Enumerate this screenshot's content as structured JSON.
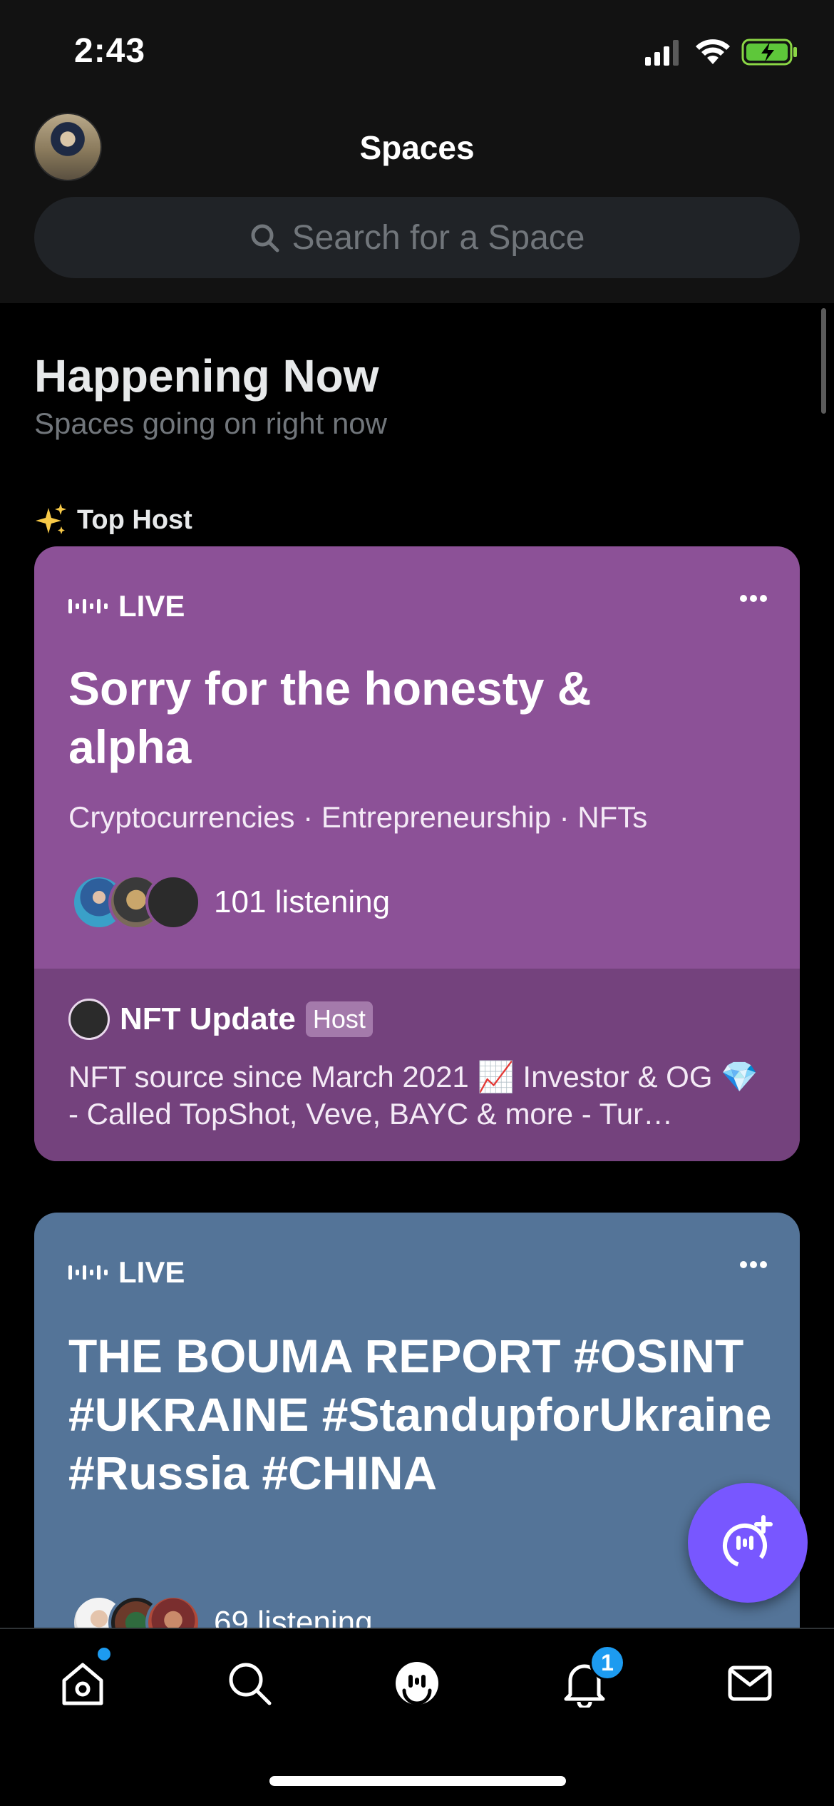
{
  "status_bar": {
    "time": "2:43"
  },
  "header": {
    "title": "Spaces",
    "search_placeholder": "Search for a Space"
  },
  "section": {
    "title": "Happening Now",
    "subtitle": "Spaces going on right now",
    "category_label": "Top Host"
  },
  "cards": [
    {
      "live_label": "LIVE",
      "title": "Sorry for the honesty & alpha",
      "topics": "Cryptocurrencies · Entrepreneurship · NFTs",
      "listening": "101 listening",
      "color": "#8c5197",
      "host": {
        "name": "NFT Update",
        "badge": "Host",
        "bio": "NFT source since March 2021 📈 Investor & OG 💎 - Called TopShot, Veve, BAYC & more - Tur…"
      }
    },
    {
      "live_label": "LIVE",
      "title": "THE BOUMA REPORT #OSINT #UKRAINE #StandupforUkraine #Russia #CHINA",
      "listening": "69 listening",
      "color": "#547498"
    }
  ],
  "tab_bar": {
    "notifications_count": "1",
    "accent": "#1d9bf0"
  },
  "fab": {
    "color": "#7857ff",
    "icon": "start-space-icon"
  }
}
